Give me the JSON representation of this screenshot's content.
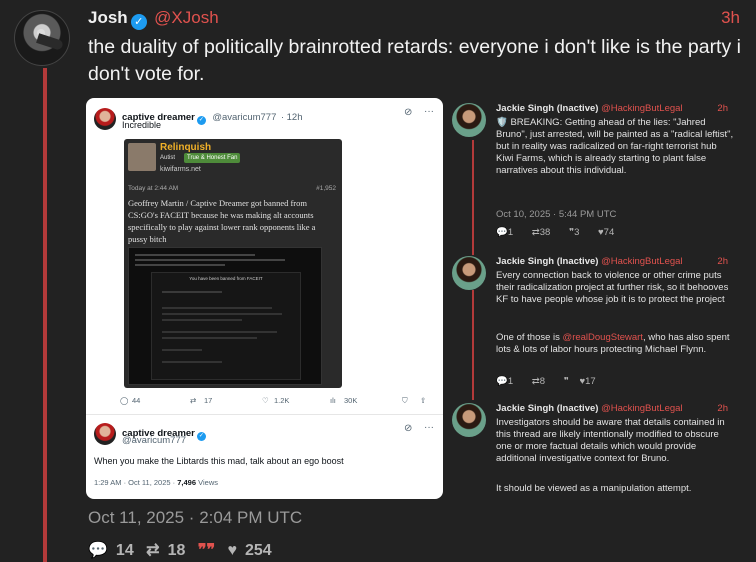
{
  "post": {
    "author": "Josh",
    "handle": "@XJosh",
    "time": "3h",
    "text": "the duality of politically brainrotted retards: everyone i don't like is the party i don't vote for.",
    "date": "Oct 11, 2025 · 2:04 PM UTC",
    "stats": {
      "replies": "14",
      "reposts": "18",
      "quotes": "",
      "likes": "254"
    }
  },
  "embed": {
    "tweet1": {
      "name": "captive dreamer",
      "handle": "@avaricum777",
      "time": "· 12h",
      "text": "Incredible",
      "kf": {
        "user": "Relinquish",
        "role": "Autist",
        "badge": "True & Honest Fan",
        "site": "kiwifarms.net",
        "today": "Today at 2:44 AM",
        "num": "#1,952",
        "body": "Geoffrey Martin / Captive Dreamer got banned from CS:GO's FACEIT because he was making alt accounts specifically to play against lower rank opponents like a pussy bitch",
        "faceit_title": "You have been banned from FACEIT"
      },
      "actions": {
        "replies": "44",
        "reposts": "17",
        "views": "1.2K",
        "bookmarks": "30K"
      }
    },
    "tweet2": {
      "name": "captive dreamer",
      "handle": "@avaricum777",
      "text": "When you make the Libtards this mad, talk about an ego boost",
      "meta_prefix": "1:29 AM · Oct 11, 2025 · ",
      "views": "7,496",
      "views_label": " Views"
    }
  },
  "replies": [
    {
      "name": "Jackie Singh (Inactive)",
      "handle": "@HackingButLegal",
      "time": "2h",
      "text": "🛡️ BREAKING: Getting ahead of the lies: \"Jahred Bruno\", just arrested, will be painted as a \"radical leftist\", but in reality was radicalized on far-right terrorist hub Kiwi Farms, which is already starting to plant false narratives about this individual.",
      "date": "Oct 10, 2025 · 5:44 PM UTC",
      "stats": {
        "replies": "1",
        "reposts": "38",
        "quotes": "3",
        "likes": "74"
      }
    },
    {
      "name": "Jackie Singh (Inactive)",
      "handle": "@HackingButLegal",
      "time": "2h",
      "text": "Every connection back to violence or other crime puts their radicalization project at further risk, so it behooves KF to have people whose job it is to protect the project",
      "text2_pre": "One of those is ",
      "text2_mention": "@realDougStewart",
      "text2_post": ", who has also spent lots & lots of labor hours protecting Michael Flynn.",
      "stats": {
        "replies": "1",
        "reposts": "8",
        "quotes": "",
        "likes": "17"
      }
    },
    {
      "name": "Jackie Singh (Inactive)",
      "handle": "@HackingButLegal",
      "time": "2h",
      "text": "Investigators should be aware that details contained in this thread are likely intentionally modified to obscure one or more factual details which would provide additional investigative context for Bruno.",
      "text2": "It should be viewed as a manipulation attempt."
    }
  ],
  "colors": {
    "accent": "#e0524e",
    "thread": "#b33a3a",
    "bg": "#222222"
  }
}
